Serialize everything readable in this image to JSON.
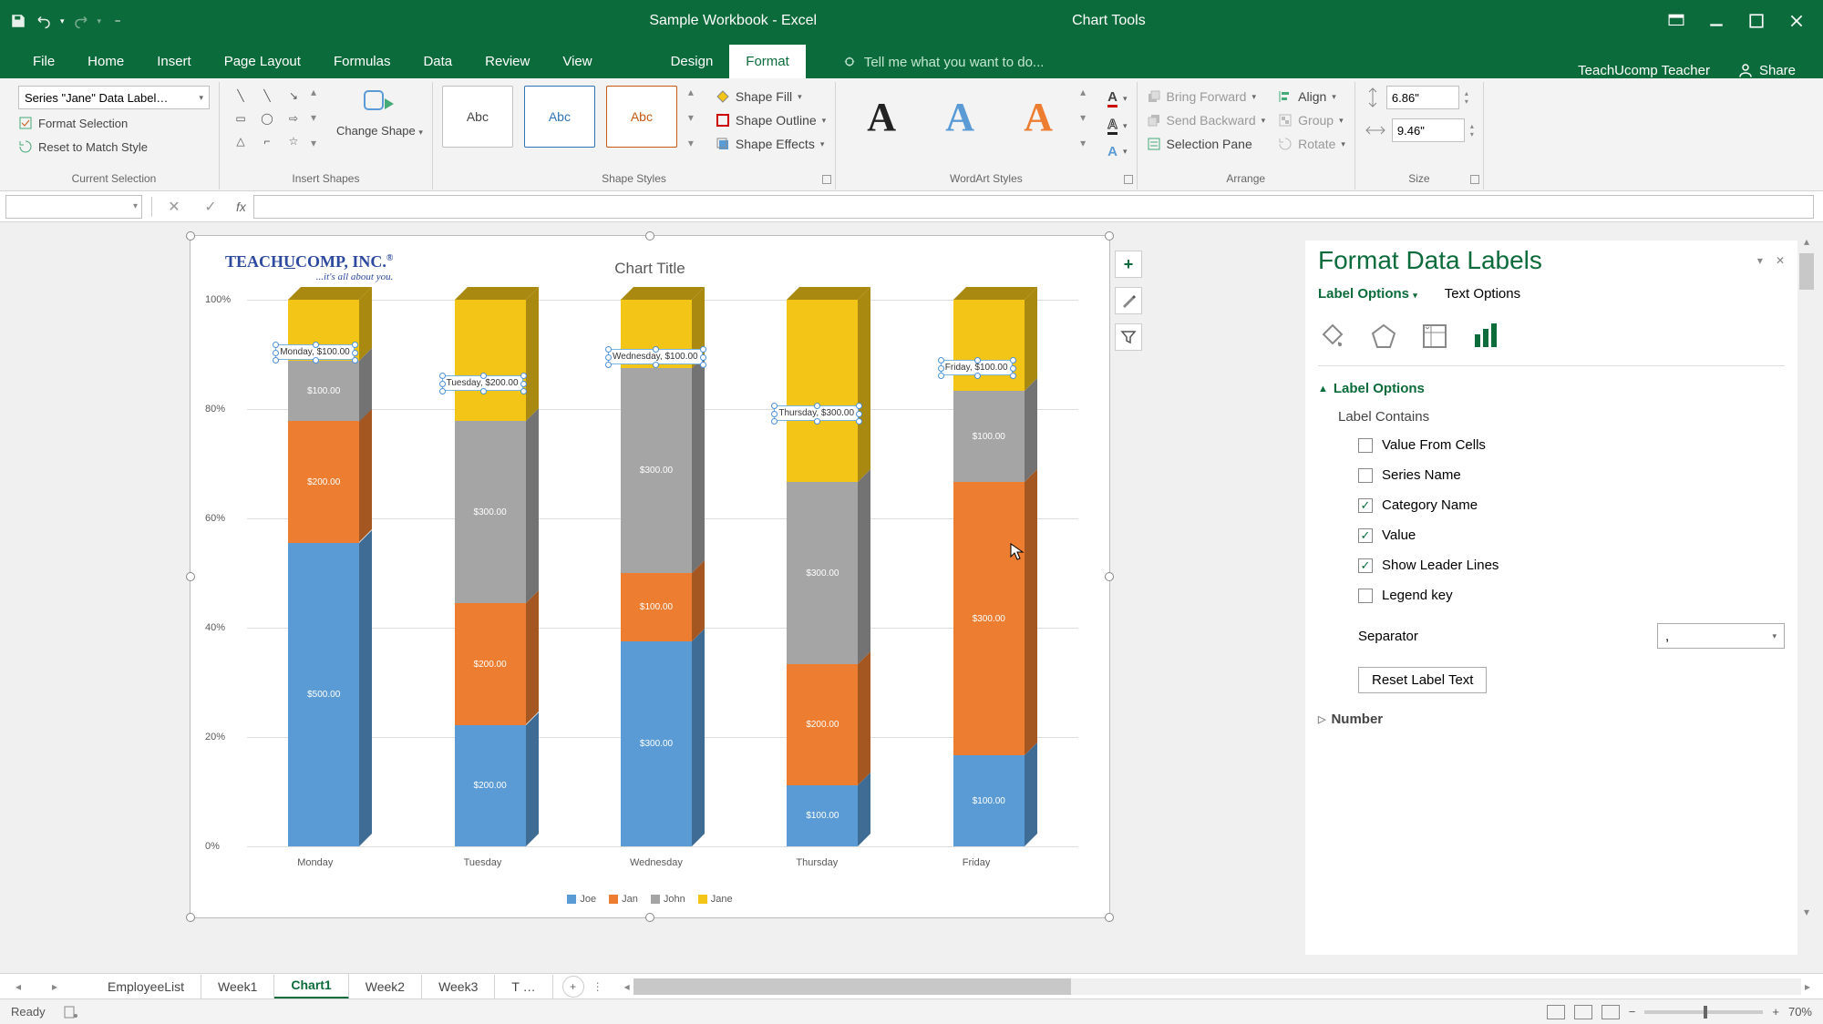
{
  "titlebar": {
    "app_title": "Sample Workbook - Excel",
    "context_title": "Chart Tools"
  },
  "tabs": {
    "file": "File",
    "home": "Home",
    "insert": "Insert",
    "page_layout": "Page Layout",
    "formulas": "Formulas",
    "data": "Data",
    "review": "Review",
    "view": "View",
    "design": "Design",
    "format": "Format",
    "tellme": "Tell me what you want to do...",
    "user": "TeachUcomp Teacher",
    "share": "Share"
  },
  "ribbon": {
    "selection_dropdown": "Series \"Jane\" Data Label…",
    "format_selection": "Format Selection",
    "reset_match": "Reset to Match Style",
    "group_current": "Current Selection",
    "change_shape": "Change Shape",
    "group_insert_shapes": "Insert Shapes",
    "abc": "Abc",
    "shape_fill": "Shape Fill",
    "shape_outline": "Shape Outline",
    "shape_effects": "Shape Effects",
    "group_shape_styles": "Shape Styles",
    "group_wordart": "WordArt Styles",
    "bring_forward": "Bring Forward",
    "send_backward": "Send Backward",
    "selection_pane": "Selection Pane",
    "group_arrange": "Arrange",
    "align": "Align",
    "group_btn": "Group",
    "rotate": "Rotate",
    "height": "6.86\"",
    "width": "9.46\"",
    "group_size": "Size"
  },
  "chart": {
    "logo_main": "TEACHUCOMP, INC.",
    "logo_sub": "...it's all about you.",
    "title": "Chart Title",
    "yticks": [
      "0%",
      "20%",
      "40%",
      "60%",
      "80%",
      "100%"
    ]
  },
  "chart_data": {
    "type": "bar_stacked_100",
    "categories": [
      "Monday",
      "Tuesday",
      "Wednesday",
      "Thursday",
      "Friday"
    ],
    "series": [
      {
        "name": "Joe",
        "color": "#5b9bd5",
        "values": [
          500,
          200,
          300,
          100,
          100
        ]
      },
      {
        "name": "Jan",
        "color": "#ed7d31",
        "values": [
          200,
          200,
          100,
          200,
          300
        ]
      },
      {
        "name": "John",
        "color": "#a5a5a5",
        "values": [
          100,
          300,
          300,
          300,
          100
        ]
      },
      {
        "name": "Jane",
        "color": "#f3c517",
        "values": [
          100,
          200,
          100,
          300,
          100
        ]
      }
    ],
    "ylabel": "",
    "xlabel": "",
    "ylim": [
      0,
      100
    ],
    "data_labels": {
      "Monday": {
        "Joe": "$500.00",
        "Jan": "$200.00",
        "John": "$100.00",
        "Jane": "Monday, $100.00"
      },
      "Tuesday": {
        "Joe": "$200.00",
        "Jan": "$200.00",
        "John": "$300.00",
        "Jane": "Tuesday, $200.00"
      },
      "Wednesday": {
        "Joe": "$300.00",
        "Jan": "$100.00",
        "John": "$300.00",
        "Jane": "Wednesday, $100.00"
      },
      "Thursday": {
        "Joe": "$100.00",
        "Jan": "$200.00",
        "John": "$300.00",
        "Jane": "Thursday, $300.00"
      },
      "Friday": {
        "Joe": "$100.00",
        "Jan": "$300.00",
        "John": "$100.00",
        "Jane": "Friday, $100.00"
      }
    }
  },
  "pane": {
    "title": "Format Data Labels",
    "label_options": "Label Options",
    "text_options": "Text Options",
    "section_label_options": "Label Options",
    "label_contains": "Label Contains",
    "cb_value_from_cells": "Value From Cells",
    "cb_series_name": "Series Name",
    "cb_category_name": "Category Name",
    "cb_value": "Value",
    "cb_show_leader": "Show Leader Lines",
    "cb_legend_key": "Legend key",
    "separator": "Separator",
    "separator_value": ",",
    "reset": "Reset Label Text",
    "number": "Number"
  },
  "sheets": {
    "s1": "EmployeeList",
    "s2": "Week1",
    "s3": "Chart1",
    "s4": "Week2",
    "s5": "Week3",
    "s6": "T …"
  },
  "status": {
    "ready": "Ready",
    "zoom": "70%"
  }
}
